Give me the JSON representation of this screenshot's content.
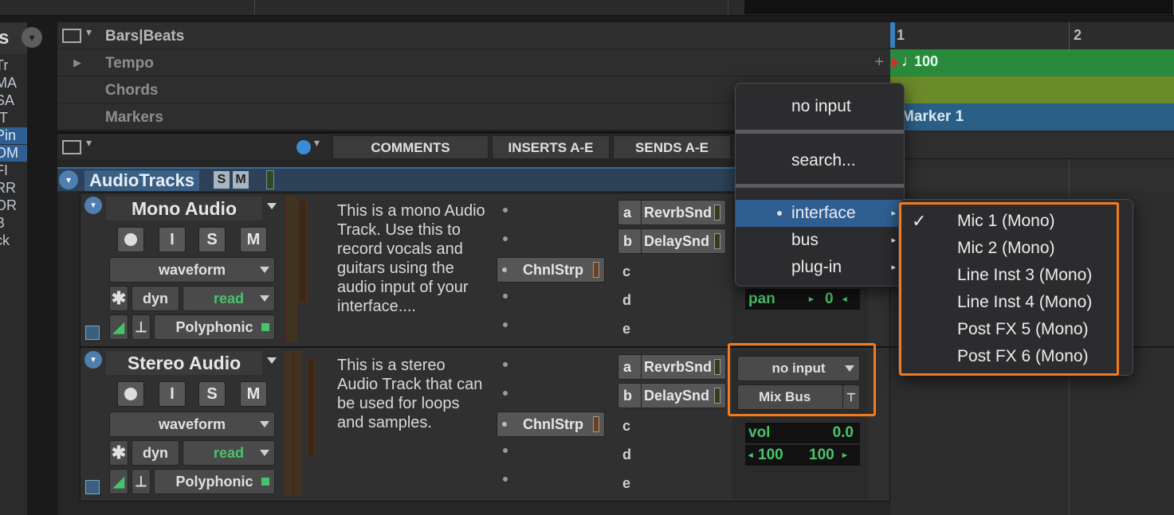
{
  "left_list": {
    "items": [
      "Tr",
      "MA",
      "SA",
      "tT",
      "Pin",
      "OM",
      "FI",
      "RR",
      "OR",
      "B",
      "ck"
    ],
    "header_fragment": "s"
  },
  "rulers": {
    "bars_beats": "Bars|Beats",
    "tempo": "Tempo",
    "chords": "Chords",
    "markers": "Markers",
    "add_symbol": "+"
  },
  "timeline": {
    "bar1": "1",
    "bar2": "2",
    "tempo_value": "100",
    "marker_label": "Marker 1",
    "colors": {
      "tempo": "#2a8a3c",
      "chords": "#6b8a2a",
      "markers": "#2a5f86"
    }
  },
  "column_headers": {
    "comments": "COMMENTS",
    "inserts": "INSERTS A-E",
    "sends": "SENDS A-E"
  },
  "group": {
    "name": "AudioTracks",
    "solo": "S",
    "mute": "M"
  },
  "tracks": [
    {
      "name": "Mono Audio",
      "rec": "",
      "input_monitor": "I",
      "solo": "S",
      "mute": "M",
      "view": "waveform",
      "dyn": "dyn",
      "automation": "read",
      "elastic": "Polyphonic",
      "comment": "This is a mono Audio Track. Use this to record vocals and guitars using the audio input of your interface....",
      "insert": "ChnlStrp",
      "sends": [
        {
          "slot": "a",
          "name": "RevrbSnd"
        },
        {
          "slot": "b",
          "name": "DelaySnd"
        },
        {
          "slot": "c",
          "name": ""
        },
        {
          "slot": "d",
          "name": ""
        },
        {
          "slot": "e",
          "name": ""
        }
      ],
      "pan_label": "pan",
      "pan_value": "0"
    },
    {
      "name": "Stereo Audio",
      "rec": "",
      "input_monitor": "I",
      "solo": "S",
      "mute": "M",
      "view": "waveform",
      "dyn": "dyn",
      "automation": "read",
      "elastic": "Polyphonic",
      "comment": "This is a stereo Audio Track that can be used for loops and samples.",
      "insert": "ChnlStrp",
      "sends": [
        {
          "slot": "a",
          "name": "RevrbSnd"
        },
        {
          "slot": "b",
          "name": "DelaySnd"
        },
        {
          "slot": "c",
          "name": ""
        },
        {
          "slot": "d",
          "name": ""
        },
        {
          "slot": "e",
          "name": ""
        }
      ],
      "input": "no input",
      "output": "Mix Bus",
      "vol_label": "vol",
      "vol_value": "0.0",
      "pan_left": "100",
      "pan_right": "100"
    }
  ],
  "input_menu": {
    "items": [
      "no input",
      "search...",
      "interface",
      "bus",
      "plug-in"
    ],
    "highlighted": "interface"
  },
  "interface_submenu": {
    "items": [
      "Mic 1 (Mono)",
      "Mic 2 (Mono)",
      "Line Inst 3 (Mono)",
      "Line Inst 4 (Mono)",
      "Post FX 5 (Mono)",
      "Post FX 6 (Mono)"
    ],
    "checked": "Mic 1 (Mono)",
    "check_mark": "✓"
  },
  "accent_colors": {
    "highlight_orange": "#f07b20",
    "menu_selection": "#2f5f92",
    "green_value": "#49c36b"
  }
}
